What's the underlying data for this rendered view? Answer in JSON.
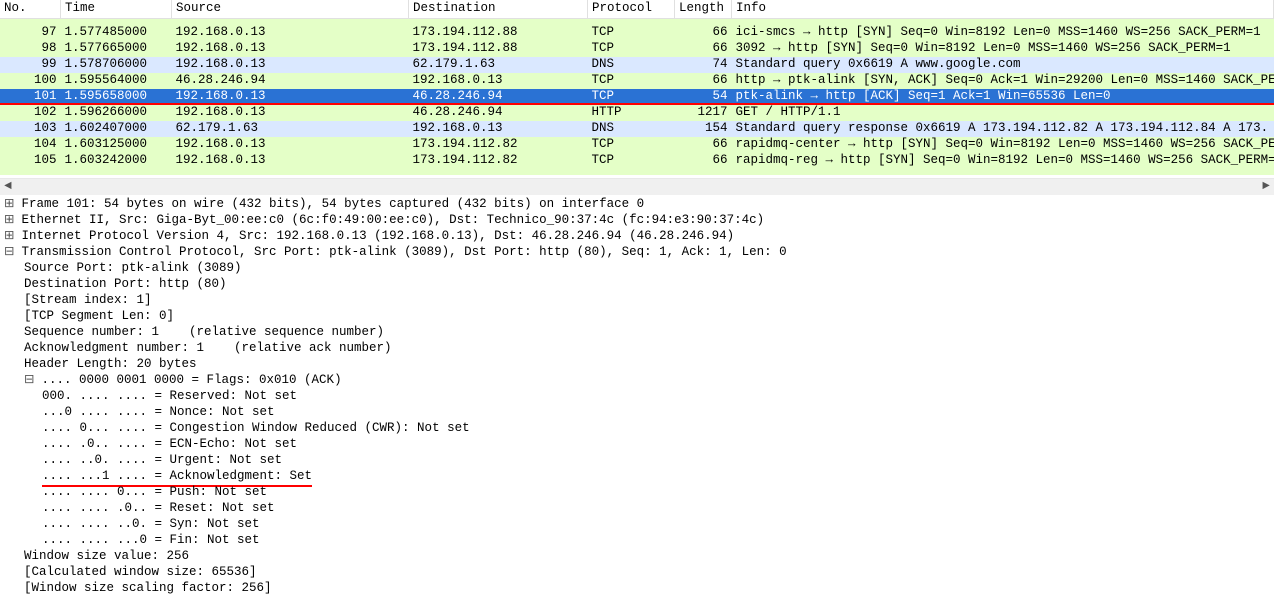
{
  "columns": {
    "no": "No.",
    "time": "Time",
    "source": "Source",
    "destination": "Destination",
    "protocol": "Protocol",
    "length": "Length",
    "info": "Info"
  },
  "rows": [
    {
      "no": "97",
      "time": "1.577485000",
      "src": "192.168.0.13",
      "dst": "173.194.112.88",
      "proto": "TCP",
      "len": "66",
      "info": "ici-smcs → http [SYN] Seq=0 Win=8192 Len=0 MSS=1460 WS=256 SACK_PERM=1",
      "css": "row-green"
    },
    {
      "no": "98",
      "time": "1.577665000",
      "src": "192.168.0.13",
      "dst": "173.194.112.88",
      "proto": "TCP",
      "len": "66",
      "info": "3092 → http [SYN] Seq=0 Win=8192 Len=0 MSS=1460 WS=256 SACK_PERM=1",
      "css": "row-green"
    },
    {
      "no": "99",
      "time": "1.578706000",
      "src": "192.168.0.13",
      "dst": "62.179.1.63",
      "proto": "DNS",
      "len": "74",
      "info": "Standard query 0x6619  A www.google.com",
      "css": "row-blue"
    },
    {
      "no": "100",
      "time": "1.595564000",
      "src": "46.28.246.94",
      "dst": "192.168.0.13",
      "proto": "TCP",
      "len": "66",
      "info": "http → ptk-alink [SYN, ACK] Seq=0 Ack=1 Win=29200 Len=0 MSS=1460 SACK_PE",
      "css": "row-green"
    },
    {
      "no": "101",
      "time": "1.595658000",
      "src": "192.168.0.13",
      "dst": "46.28.246.94",
      "proto": "TCP",
      "len": "54",
      "info": "ptk-alink → http [ACK] Seq=1 Ack=1 Win=65536 Len=0",
      "css": "row-selected red-underline"
    },
    {
      "no": "102",
      "time": "1.596266000",
      "src": "192.168.0.13",
      "dst": "46.28.246.94",
      "proto": "HTTP",
      "len": "1217",
      "info": "GET / HTTP/1.1",
      "css": "row-green"
    },
    {
      "no": "103",
      "time": "1.602407000",
      "src": "62.179.1.63",
      "dst": "192.168.0.13",
      "proto": "DNS",
      "len": "154",
      "info": "Standard query response 0x6619  A 173.194.112.82 A 173.194.112.84 A 173.",
      "css": "row-blue"
    },
    {
      "no": "104",
      "time": "1.603125000",
      "src": "192.168.0.13",
      "dst": "173.194.112.82",
      "proto": "TCP",
      "len": "66",
      "info": "rapidmq-center → http [SYN] Seq=0 Win=8192 Len=0 MSS=1460 WS=256 SACK_PE",
      "css": "row-green"
    },
    {
      "no": "105",
      "time": "1.603242000",
      "src": "192.168.0.13",
      "dst": "173.194.112.82",
      "proto": "TCP",
      "len": "66",
      "info": "rapidmq-reg → http [SYN] Seq=0 Win=8192 Len=0 MSS=1460 WS=256 SACK_PERM=",
      "css": "row-green"
    }
  ],
  "details": {
    "frame": "Frame 101: 54 bytes on wire (432 bits), 54 bytes captured (432 bits) on interface 0",
    "eth": "Ethernet II, Src: Giga-Byt_00:ee:c0 (6c:f0:49:00:ee:c0), Dst: Technico_90:37:4c (fc:94:e3:90:37:4c)",
    "ip": "Internet Protocol Version 4, Src: 192.168.0.13 (192.168.0.13), Dst: 46.28.246.94 (46.28.246.94)",
    "tcp": "Transmission Control Protocol, Src Port: ptk-alink (3089), Dst Port: http (80), Seq: 1, Ack: 1, Len: 0",
    "src_port": "Source Port: ptk-alink (3089)",
    "dst_port": "Destination Port: http (80)",
    "stream": "[Stream index: 1]",
    "seglen": "[TCP Segment Len: 0]",
    "seq": "Sequence number: 1    (relative sequence number)",
    "ack": "Acknowledgment number: 1    (relative ack number)",
    "hdrlen": "Header Length: 20 bytes",
    "flags": ".... 0000 0001 0000 = Flags: 0x010 (ACK)",
    "f_res": "000. .... .... = Reserved: Not set",
    "f_nonce": "...0 .... .... = Nonce: Not set",
    "f_cwr": ".... 0... .... = Congestion Window Reduced (CWR): Not set",
    "f_ecn": ".... .0.. .... = ECN-Echo: Not set",
    "f_urg": ".... ..0. .... = Urgent: Not set",
    "f_ack": ".... ...1 .... = Acknowledgment: Set",
    "f_psh": ".... .... 0... = Push: Not set",
    "f_rst": ".... .... .0.. = Reset: Not set",
    "f_syn": ".... .... ..0. = Syn: Not set",
    "f_fin": ".... .... ...0 = Fin: Not set",
    "win": "Window size value: 256",
    "cwin": "[Calculated window size: 65536]",
    "wscale": "[Window size scaling factor: 256]"
  },
  "glyph": {
    "plus": "⊞",
    "minus": "⊟",
    "left": "◄",
    "right": "►"
  }
}
